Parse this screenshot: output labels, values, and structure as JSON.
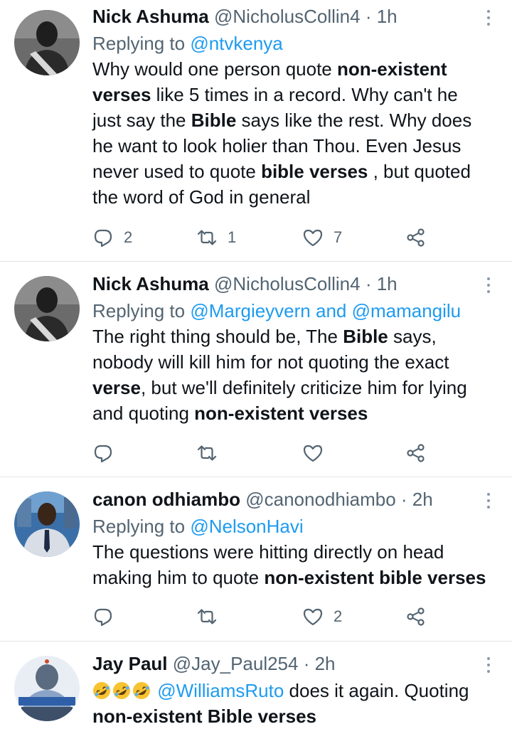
{
  "tweets": [
    {
      "name": "Nick Ashuma",
      "handle": "@NicholusCollin4",
      "time": "· 1h",
      "replying_label": "Replying to ",
      "replying_to": "@ntvkenya",
      "text": [
        "Why would one person quote ",
        "non-existent verses",
        " like 5 times in a record. Why can't he just say the ",
        "Bible",
        " says like the rest. Why does he want to look holier than Thou. Even Jesus never used to quote ",
        "bible verses",
        " , but quoted the word of God in general"
      ],
      "replies": "2",
      "retweets": "1",
      "likes": "7"
    },
    {
      "name": "Nick Ashuma",
      "handle": "@NicholusCollin4",
      "time": "· 1h",
      "replying_label": "Replying to ",
      "replying_to": "@Margieyvern and @mamangilu",
      "text": [
        "The right thing should be, The ",
        "Bible",
        " says, nobody will kill him for not quoting the exact ",
        "verse",
        ", but we'll definitely criticize him for lying and quoting ",
        "non-existent verses"
      ],
      "replies": "",
      "retweets": "",
      "likes": ""
    },
    {
      "name": "canon odhiambo",
      "handle": "@canonodhiambo",
      "time": "· 2h",
      "replying_label": "Replying to ",
      "replying_to": "@NelsonHavi",
      "text": [
        "The questions were hitting directly on head making him to quote ",
        "non-existent bible verses"
      ],
      "replies": "",
      "retweets": "",
      "likes": "2"
    },
    {
      "name": "Jay Paul",
      "handle": "@Jay_Paul254",
      "time": "· 2h",
      "mention": "@WilliamsRuto",
      "text": [
        " does it again. Quoting ",
        "non-existent Bible verses"
      ]
    }
  ],
  "icons": {
    "reply": "reply-icon",
    "retweet": "retweet-icon",
    "like": "heart-icon",
    "share": "share-icon",
    "more": "more-vertical-icon",
    "emoji": "rolling-on-floor-laughing-emoji"
  },
  "colors": {
    "link": "#1d9bf0",
    "secondary_text": "#536471",
    "primary_text": "#0f1419",
    "divider": "#e1e4e8"
  }
}
